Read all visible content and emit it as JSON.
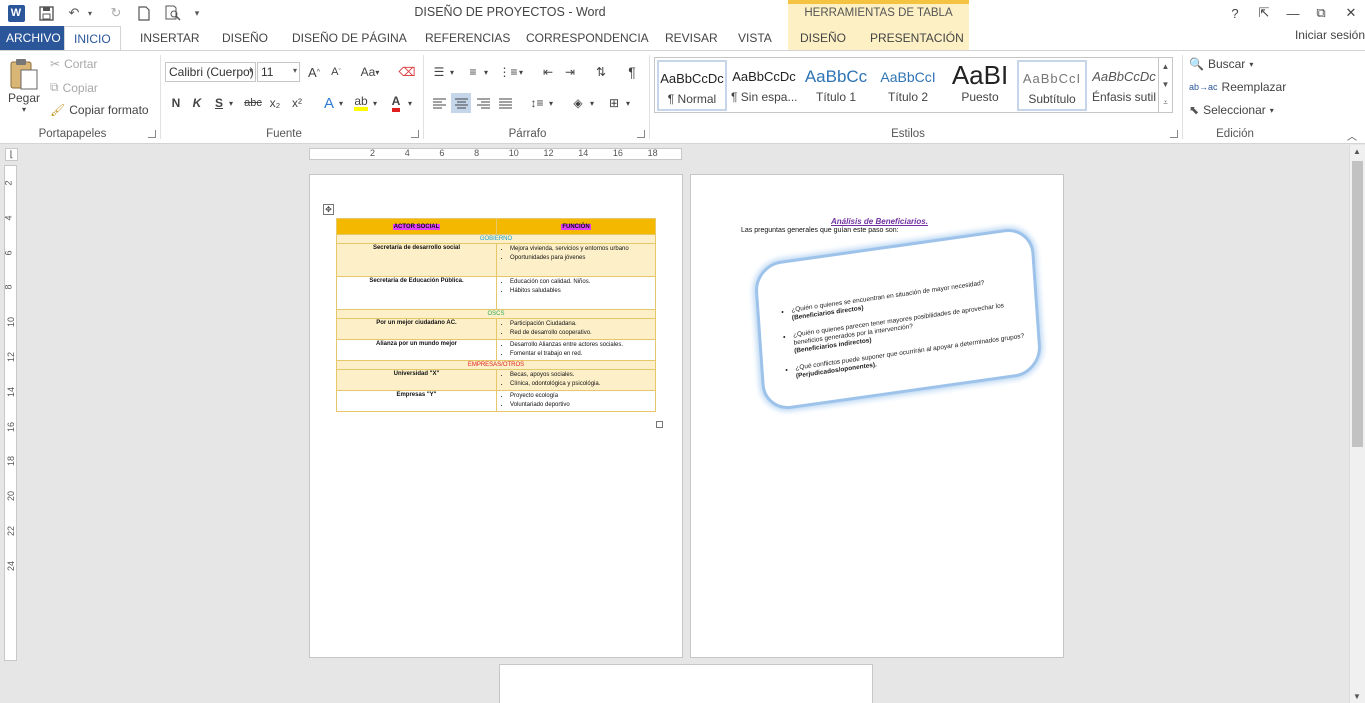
{
  "window": {
    "title": "DISEÑO DE PROYECTOS - Word",
    "tools_tab": "HERRAMIENTAS DE TABLA",
    "help": "?",
    "ribbon_opts": "⇱",
    "minimize": "—",
    "restore": "⧉",
    "close": "✕"
  },
  "tabs": {
    "file": "ARCHIVO",
    "home": "INICIO",
    "insert": "INSERTAR",
    "design": "DISEÑO",
    "page_layout": "DISEÑO DE PÁGINA",
    "references": "REFERENCIAS",
    "mailings": "CORRESPONDENCIA",
    "review": "REVISAR",
    "view": "VISTA",
    "tbl_design": "DISEÑO",
    "tbl_layout": "PRESENTACIÓN",
    "signin": "Iniciar sesión"
  },
  "clipboard": {
    "paste": "Pegar",
    "cut": "Cortar",
    "copy": "Copiar",
    "format_painter": "Copiar formato",
    "label": "Portapapeles"
  },
  "font": {
    "name": "Calibri (Cuerpo)",
    "size": "11",
    "label": "Fuente",
    "bold": "N",
    "italic": "K",
    "underline": "S",
    "strike": "abc",
    "sub": "x₂",
    "sup": "x²",
    "grow": "A",
    "shrink": "A",
    "case": "Aa"
  },
  "paragraph": {
    "label": "Párrafo",
    "pilcrow": "¶"
  },
  "styles": {
    "label": "Estilos",
    "items": [
      {
        "preview": "AaBbCcDc",
        "name": "¶ Normal"
      },
      {
        "preview": "AaBbCcDc",
        "name": "¶ Sin espa..."
      },
      {
        "preview": "AaBbCc",
        "name": "Título 1"
      },
      {
        "preview": "AaBbCcI",
        "name": "Título 2"
      },
      {
        "preview": "AaBI",
        "name": "Puesto"
      },
      {
        "preview": "AaBbCcI",
        "name": "Subtítulo"
      },
      {
        "preview": "AaBbCcDc",
        "name": "Énfasis sutil"
      }
    ]
  },
  "editing": {
    "find": "Buscar",
    "replace": "Reemplazar",
    "select": "Seleccionar",
    "label": "Edición"
  },
  "ruler": {
    "h": [
      "2",
      "4",
      "6",
      "8",
      "10",
      "12",
      "14",
      "16",
      "18"
    ],
    "v": [
      "2",
      "4",
      "6",
      "8",
      "10",
      "12",
      "14",
      "16",
      "18",
      "20",
      "22",
      "24"
    ]
  },
  "table": {
    "headers": [
      "ACTOR SOCIAL",
      "FUNCIÓN"
    ],
    "sections": [
      {
        "title": "GOBIERNO",
        "color": "#1a9fd1",
        "rows": [
          {
            "actor": "Secretaría de desarrollo social",
            "items": [
              "Mejora vivienda, servicios y entornos urbano",
              "Oportunidades para jóvenes"
            ]
          },
          {
            "actor": "Secretaría de Educación Pública.",
            "items": [
              "Educación  con calidad. Niños.",
              "Hábitos saludables"
            ]
          }
        ]
      },
      {
        "title": "OSCS",
        "color": "#2eaa5c",
        "rows": [
          {
            "actor": "Por un mejor ciudadano AC.",
            "items": [
              "Participación  Ciudadana.",
              "Red  de desarrollo cooperativo."
            ]
          },
          {
            "actor": "Alianza por un mundo mejor",
            "items": [
              "Desarrollo Alianzas entre actores sociales.",
              "Fomentar el trabajo en red."
            ]
          }
        ]
      },
      {
        "title": "EMPRESAS/OTROS",
        "color": "#e02020",
        "rows": [
          {
            "actor": "Universidad \"X\"",
            "items": [
              "Becas, apoyos sociales.",
              "Clínica, odontológica y psicológia."
            ]
          },
          {
            "actor": "Empresas \"Y\"",
            "items": [
              "Proyecto ecología",
              "Voluntariado deportivo"
            ]
          }
        ]
      }
    ]
  },
  "page2": {
    "title": "Análisis de Beneficiarios.",
    "subtitle": "Las preguntas generales que guían este paso son:",
    "questions": [
      {
        "q": "¿Quién o quienes se encuentran en situación de mayor necesidad?",
        "tag": "(Beneficiarios directos)"
      },
      {
        "q": "¿Quién o quienes parecen tener mayores posibilidades de aprovechar los beneficios generados por la intervención?",
        "tag": "(Beneficiarios indirectos)"
      },
      {
        "q": "¿Qué conflictos puede suponer que ocurrirán al apoyar a determinados grupos?",
        "tag": "(Perjudicados/oponentes)."
      }
    ]
  }
}
